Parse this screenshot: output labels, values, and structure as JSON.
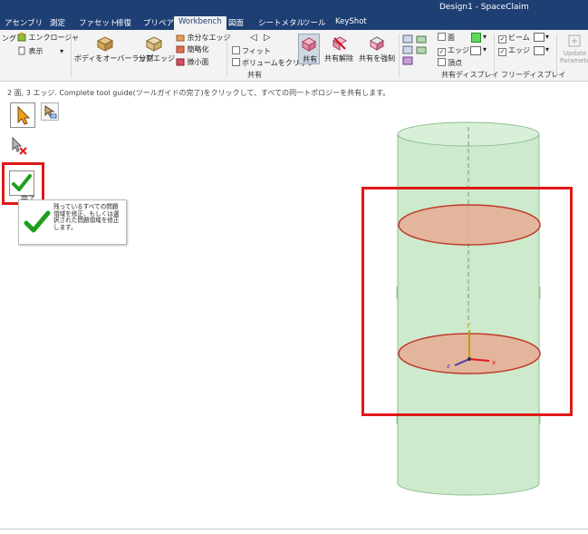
{
  "window": {
    "title": "Design1 - SpaceClaim"
  },
  "tabs": [
    {
      "label": "アセンブリ"
    },
    {
      "label": "測定"
    },
    {
      "label": "ファセット"
    },
    {
      "label": "修復"
    },
    {
      "label": "プリペア"
    },
    {
      "label": "Workbench"
    },
    {
      "label": "図面"
    },
    {
      "label": "シートメタル"
    },
    {
      "label": "ツール"
    },
    {
      "label": "KeyShot"
    }
  ],
  "ribbon": {
    "partial_left": {
      "item1": "ング",
      "item2": "エンクロージャ",
      "item3": "表示"
    },
    "tools": {
      "overlap": "ボディをオーバーラップ",
      "split_edge": "分割エッジ",
      "extra_edges": "余分なエッジ",
      "simplify": "簡略化",
      "small_faces": "微小面"
    },
    "share_group": {
      "fit": "フィット",
      "volume_clip": "ボリュームをクリップ",
      "share": "共有",
      "unshare": "共有解除",
      "force_share": "共有を強制",
      "label": "共有"
    },
    "display_group": {
      "face": "面",
      "edge": "エッジ",
      "vertex": "頂点",
      "label": "共有ディスプレイ"
    },
    "free_group": {
      "beam": "ビーム",
      "edge": "エッジ",
      "label": "フリーディスプレイ"
    },
    "update": {
      "line1": "Update",
      "line2": "Parameter"
    }
  },
  "prompt": "2 面, 3 エッジ. Complete tool guide(ツールガイドの完了)をクリックして、すべての同一トポロジーを共有します。",
  "tool_guides": {
    "complete_label": "完了",
    "tooltip": "残っているすべての問題領域を修正、もしくは選択された問題領域を修正します。"
  },
  "axes": {
    "x": "x",
    "y": "y",
    "z": "z"
  },
  "colors": {
    "title_bar": "#1e3f73",
    "ribbon_bg": "#f3f3f3",
    "cylinder_fill": "#cdeacd",
    "cylinder_edge": "#8fbd8f",
    "shared_face_fill": "#e8a890",
    "shared_face_edge": "#c0392b",
    "highlight_red": "#e01818",
    "check_green": "#1e9e1e"
  },
  "icons": [
    "select-arrow-icon",
    "select-alt-icon",
    "deselect-icon",
    "complete-check-icon",
    "share-icon",
    "unshare-icon",
    "force-share-icon",
    "overlap-bodies-icon",
    "split-edge-icon"
  ]
}
